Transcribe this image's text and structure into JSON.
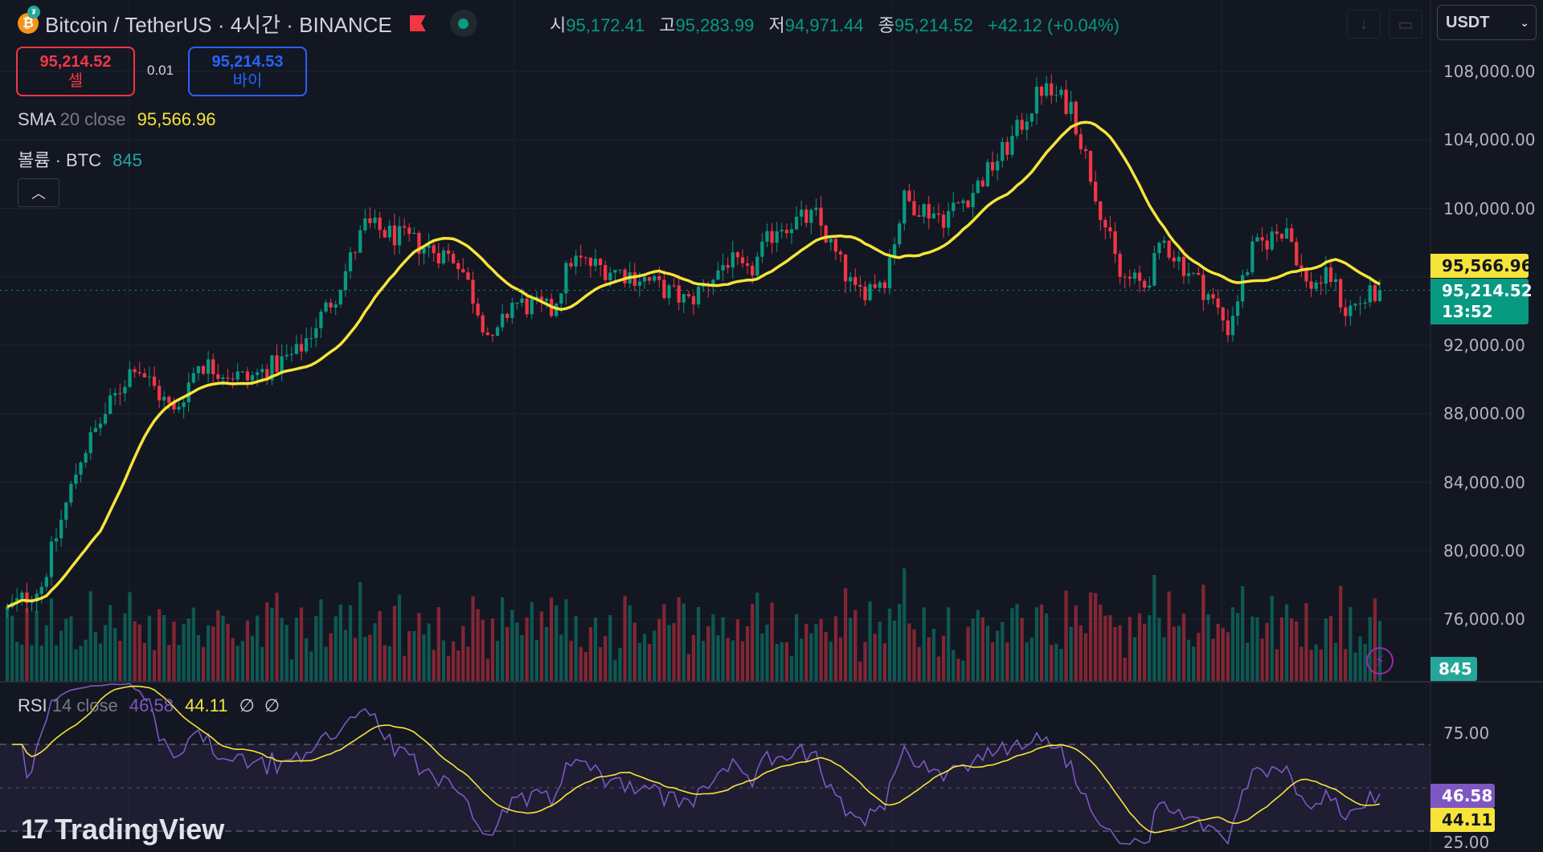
{
  "header": {
    "symbol": "Bitcoin / TetherUS · 4시간 · BINANCE",
    "coin_glyph": "₿",
    "ohlc": [
      {
        "key": "시",
        "value": "95,172.41"
      },
      {
        "key": "고",
        "value": "95,283.99"
      },
      {
        "key": "저",
        "value": "94,971.44"
      },
      {
        "key": "종",
        "value": "95,214.52"
      }
    ],
    "change": "+42.12 (+0.04%)",
    "currency": "USDT"
  },
  "trade": {
    "sell_price": "95,214.52",
    "sell_label": "셀",
    "spread": "0.01",
    "buy_price": "95,214.53",
    "buy_label": "바이"
  },
  "indicators": {
    "sma": {
      "name": "SMA",
      "params": "20 close",
      "value": "95,566.96"
    },
    "volume": {
      "name": "볼륨 · BTC",
      "value": "845"
    },
    "rsi": {
      "name": "RSI",
      "params": "14 close",
      "value": "46.58",
      "ma_value": "44.11",
      "extra1": "∅",
      "extra2": "∅"
    }
  },
  "price_axis": [
    "108,000.00",
    "104,000.00",
    "100,000.00",
    "92,000.00",
    "88,000.00",
    "84,000.00",
    "80,000.00",
    "76,000.00"
  ],
  "price_tags": {
    "sma": "95,566.96",
    "last": "95,214.52",
    "countdown": "13:52",
    "volume": "845"
  },
  "rsi_axis": [
    "75.00",
    "25.00"
  ],
  "rsi_tags": {
    "rsi": "46.58",
    "ma": "44.11"
  },
  "logo": "TradingView",
  "colors": {
    "up": "#089981",
    "down": "#f23645",
    "sma": "#f7e43b",
    "rsi": "#7e57c2",
    "bg": "#131722"
  },
  "chart_data": {
    "type": "candlestick",
    "price_range": [
      76000,
      108000
    ],
    "anchors": [
      [
        0,
        76500
      ],
      [
        7,
        78000
      ],
      [
        15,
        85500
      ],
      [
        26,
        91000
      ],
      [
        34,
        88000
      ],
      [
        39,
        91000
      ],
      [
        49,
        90000
      ],
      [
        59,
        91500
      ],
      [
        67,
        95000
      ],
      [
        73,
        99000
      ],
      [
        83,
        98000
      ],
      [
        92,
        97000
      ],
      [
        99,
        92000
      ],
      [
        103,
        94500
      ],
      [
        111,
        94000
      ],
      [
        115,
        97000
      ],
      [
        129,
        96000
      ],
      [
        139,
        94500
      ],
      [
        147,
        97000
      ],
      [
        151,
        96000
      ],
      [
        157,
        99000
      ],
      [
        165,
        99500
      ],
      [
        173,
        95000
      ],
      [
        179,
        96000
      ],
      [
        183,
        100500
      ],
      [
        191,
        99500
      ],
      [
        197,
        101000
      ],
      [
        205,
        104000
      ],
      [
        211,
        107000
      ],
      [
        217,
        106000
      ],
      [
        223,
        100000
      ],
      [
        227,
        96000
      ],
      [
        232,
        95500
      ],
      [
        236,
        98000
      ],
      [
        245,
        95000
      ],
      [
        249,
        93000
      ],
      [
        254,
        97500
      ],
      [
        261,
        99000
      ],
      [
        265,
        95500
      ],
      [
        270,
        96000
      ],
      [
        273,
        94000
      ],
      [
        280,
        95214
      ]
    ]
  }
}
